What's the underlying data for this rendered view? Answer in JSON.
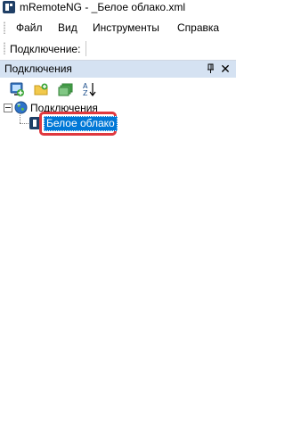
{
  "window": {
    "title": "mRemoteNG - _Белое облако.xml"
  },
  "menu": {
    "items": [
      {
        "label": "Файл"
      },
      {
        "label": "Вид"
      },
      {
        "label": "Инструменты"
      },
      {
        "label": "Справка"
      }
    ]
  },
  "quick_connect": {
    "label": "Подключение:"
  },
  "connections_panel": {
    "title": "Подключения",
    "toolbar": {
      "icons": [
        "new-connection-icon",
        "new-folder-icon",
        "view-icon",
        "sort-az-icon"
      ]
    },
    "tree": {
      "root": {
        "label": "Подключения",
        "expanded": true
      },
      "children": [
        {
          "label": "Белое облако",
          "selected": true,
          "editing": true
        }
      ]
    }
  },
  "colors": {
    "panel_header": "#d5e2f2",
    "selection": "#0078d7",
    "highlight": "#e0383e"
  }
}
